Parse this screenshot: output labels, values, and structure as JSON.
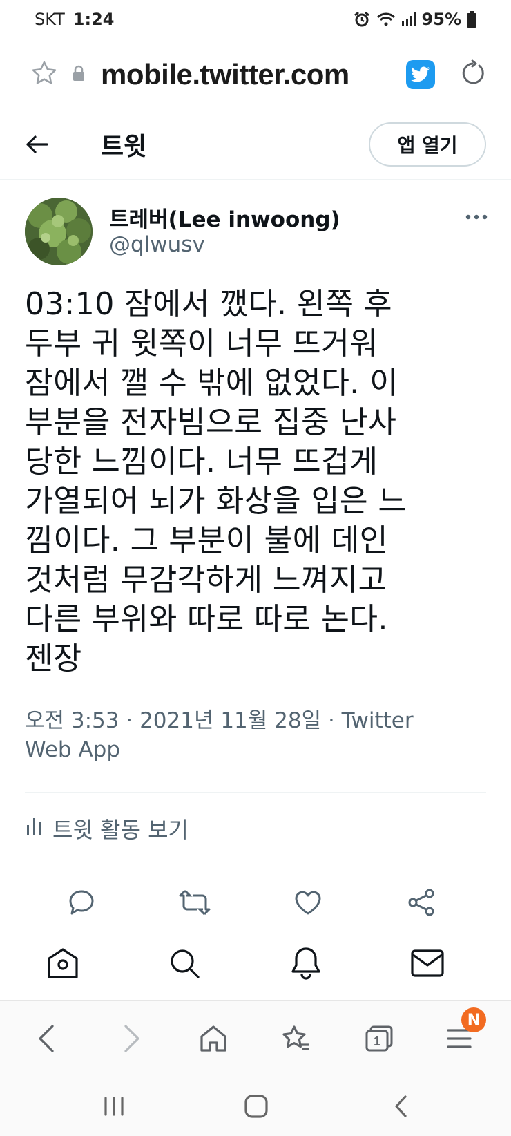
{
  "status_bar": {
    "carrier": "SKT",
    "time": "1:24",
    "battery": "95%"
  },
  "browser": {
    "url": "mobile.twitter.com"
  },
  "header": {
    "title": "트윗",
    "open_app_label": "앱 열기"
  },
  "tweet": {
    "author_name": "트레버(Lee inwoong)",
    "author_handle": "@qlwusv",
    "text": "03:10 잠에서 깼다. 왼쪽 후\n두부 귀 윗쪽이 너무 뜨거워\n잠에서 깰 수 밖에 없었다. 이\n부분을 전자빔으로 집중 난사\n당한 느낌이다. 너무 뜨겁게\n가열되어 뇌가 화상을 입은 느\n낌이다. 그 부분이 불에 데인\n것처럼 무감각하게 느껴지고\n다른 부위와 따로 따로 논다.\n젠장",
    "meta_line1": "오전 3:53 · 2021년 11월 28일 · Twitter",
    "meta_line2": "Web App",
    "activity_label": "트윗 활동 보기"
  },
  "icons": {
    "status": [
      "alarm-icon",
      "wifi-icon",
      "signal-icon",
      "battery-icon"
    ],
    "url_bar": [
      "star-icon",
      "lock-icon",
      "twitter-bird-icon",
      "reload-icon"
    ],
    "actions": [
      "reply-icon",
      "retweet-icon",
      "like-icon",
      "share-icon"
    ],
    "twitter_nav": [
      "home-icon",
      "search-icon",
      "notifications-icon",
      "messages-icon"
    ],
    "browser_nav": [
      "back-icon",
      "forward-icon",
      "home-icon",
      "bookmarks-icon",
      "tabs-icon",
      "menu-icon"
    ]
  },
  "browser_nav": {
    "tabs_count": "1",
    "menu_badge": "N"
  },
  "colors": {
    "twitter_blue": "#1d9bf0",
    "secondary_text": "#536471",
    "badge_orange": "#f26b21"
  }
}
